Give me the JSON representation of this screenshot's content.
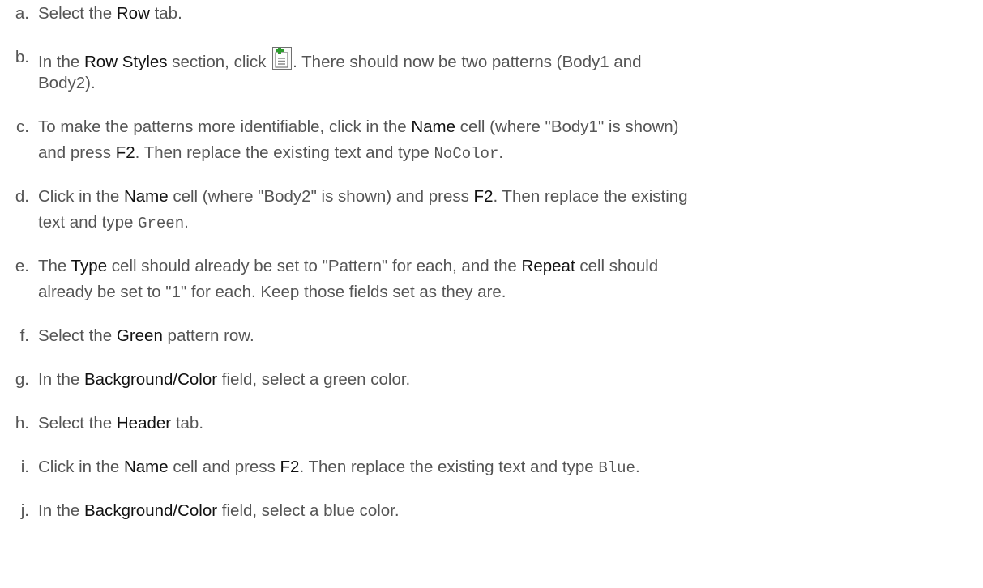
{
  "steps": [
    {
      "marker": "a.",
      "parts": [
        "Select the ",
        "Row",
        " tab."
      ]
    },
    {
      "marker": "b.",
      "parts": [
        "In the ",
        "Row Styles",
        " section, click ",
        ". There should now be two patterns (Body1 and",
        "Body2)."
      ],
      "icon": "add-row-style-icon"
    },
    {
      "marker": "c.",
      "parts": [
        "To make the patterns more identifiable, click in the ",
        "Name",
        " cell (where \"Body1\" is shown)",
        "and press ",
        "F2",
        ". Then replace the existing text and type ",
        "NoColor",
        "."
      ]
    },
    {
      "marker": "d.",
      "parts": [
        "Click in the ",
        "Name",
        " cell (where \"Body2\" is shown) and press ",
        "F2",
        ". Then replace the existing",
        "text and type ",
        "Green",
        "."
      ]
    },
    {
      "marker": "e.",
      "parts": [
        "The ",
        "Type",
        " cell should already be set to \"Pattern\" for each, and the ",
        "Repeat",
        " cell should",
        "already be set to \"1\" for each. Keep those fields set as they are."
      ]
    },
    {
      "marker": "f.",
      "parts": [
        "Select the ",
        "Green",
        " pattern row."
      ]
    },
    {
      "marker": "g.",
      "parts": [
        "In the ",
        "Background/Color",
        " field, select a green color."
      ]
    },
    {
      "marker": "h.",
      "parts": [
        "Select the ",
        "Header",
        " tab."
      ]
    },
    {
      "marker": "i.",
      "parts": [
        "Click in the ",
        "Name",
        " cell and press ",
        "F2",
        ". Then replace the existing text and type ",
        "Blue",
        "."
      ]
    },
    {
      "marker": "j.",
      "parts": [
        "In the ",
        "Background/Color",
        " field, select a blue color."
      ]
    }
  ]
}
